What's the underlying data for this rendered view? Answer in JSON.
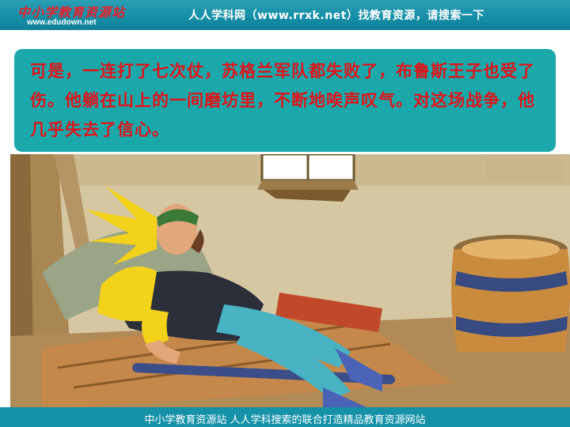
{
  "header": {
    "logo_text": "中小学教育资源站",
    "logo_url": "www.edudown.net",
    "tagline": "人人学科网（www.rrxk.net）找教育资源，请搜索一下"
  },
  "story": {
    "text": "可是，一连打了七次仗，苏格兰军队都失败了，布鲁斯王子也受了伤。他躺在山上的一间磨坊里，不断地唉声叹气。对这场战争，他几乎失去了信心。"
  },
  "footer": {
    "text": "中小学教育资源站  人人学科搜索的联合打造精品教育资源网站"
  },
  "colors": {
    "header_bg": "#168fa8",
    "textbox_bg": "#1aa8aa",
    "story_text": "#e0141a",
    "footer_bg": "#1591a8"
  },
  "illustration": {
    "icon": "prince-resting-in-mill-illustration"
  }
}
